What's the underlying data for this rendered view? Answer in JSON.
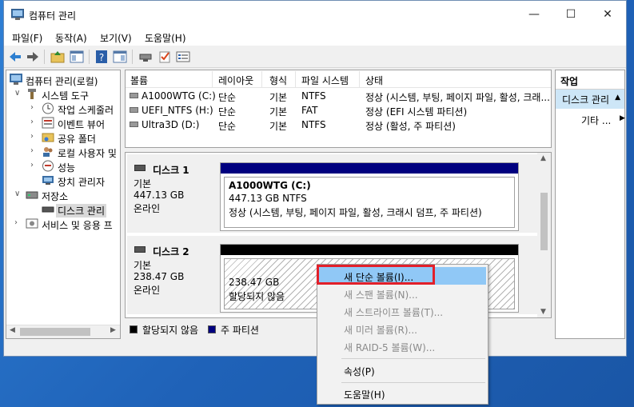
{
  "window": {
    "title": "컴퓨터 관리",
    "minimize": "—",
    "maximize": "☐",
    "close": "✕"
  },
  "menu": [
    "파일(F)",
    "동작(A)",
    "보기(V)",
    "도움말(H)"
  ],
  "tree": {
    "items": [
      {
        "label": "컴퓨터 관리(로컬)",
        "icon": "computer-icon",
        "arrow": ""
      },
      {
        "label": "시스템 도구",
        "icon": "tools-icon",
        "arrow": "∨"
      },
      {
        "label": "작업 스케줄러",
        "icon": "clock-icon",
        "arrow": "›"
      },
      {
        "label": "이벤트 뷰어",
        "icon": "event-viewer-icon",
        "arrow": "›"
      },
      {
        "label": "공유 폴더",
        "icon": "shared-folder-icon",
        "arrow": "›"
      },
      {
        "label": "로컬 사용자 및",
        "icon": "users-icon",
        "arrow": "›"
      },
      {
        "label": "성능",
        "icon": "performance-icon",
        "arrow": "›"
      },
      {
        "label": "장치 관리자",
        "icon": "device-manager-icon",
        "arrow": ""
      },
      {
        "label": "저장소",
        "icon": "storage-icon",
        "arrow": "∨"
      },
      {
        "label": "디스크 관리",
        "icon": "disk-icon",
        "arrow": ""
      },
      {
        "label": "서비스 및 응용 프",
        "icon": "services-icon",
        "arrow": "›"
      }
    ]
  },
  "volume_list": {
    "headers": [
      "볼륨",
      "레이아웃",
      "형식",
      "파일 시스템",
      "상태"
    ],
    "rows": [
      {
        "volume": "A1000WTG (C:)",
        "layout": "단순",
        "type": "기본",
        "fs": "NTFS",
        "status": "정상 (시스템, 부팅, 페이지 파일, 활성, 크래..."
      },
      {
        "volume": "UEFI_NTFS (H:)",
        "layout": "단순",
        "type": "기본",
        "fs": "FAT",
        "status": "정상 (EFI 시스템 파티션)"
      },
      {
        "volume": "Ultra3D (D:)",
        "layout": "단순",
        "type": "기본",
        "fs": "NTFS",
        "status": "정상 (활성, 주 파티션)"
      }
    ]
  },
  "disks": [
    {
      "name": "디스크 1",
      "type": "기본",
      "size": "447.13 GB",
      "status": "온라인",
      "partition": {
        "label": "A1000WTG  (C:)",
        "size": "447.13 GB NTFS",
        "status": "정상 (시스템, 부팅, 페이지 파일, 활성, 크래시 덤프, 주 파티션)"
      }
    },
    {
      "name": "디스크 2",
      "type": "기본",
      "size": "238.47 GB",
      "status": "온라인",
      "partition": {
        "label": "",
        "size": "238.47 GB",
        "status": "할당되지 않음"
      }
    }
  ],
  "legend": {
    "unallocated": "할당되지 않음",
    "primary": "주 파티션"
  },
  "actions": {
    "header": "작업",
    "section": "디스크 관리",
    "more": "기타 ..."
  },
  "context_menu": {
    "items": [
      {
        "label": "새 단순 볼륨(I)...",
        "disabled": false
      },
      {
        "label": "새 스팬 볼륨(N)...",
        "disabled": true
      },
      {
        "label": "새 스트라이프 볼륨(T)...",
        "disabled": true
      },
      {
        "label": "새 미러 볼륨(R)...",
        "disabled": true
      },
      {
        "label": "새 RAID-5 볼륨(W)...",
        "disabled": true
      },
      {
        "label": "속성(P)",
        "disabled": false
      },
      {
        "label": "도움말(H)",
        "disabled": false
      }
    ]
  },
  "colors": {
    "primary_partition": "#00007f",
    "unallocated": "#000000",
    "highlight": "#90c8f6",
    "annotation": "#e2202a"
  }
}
